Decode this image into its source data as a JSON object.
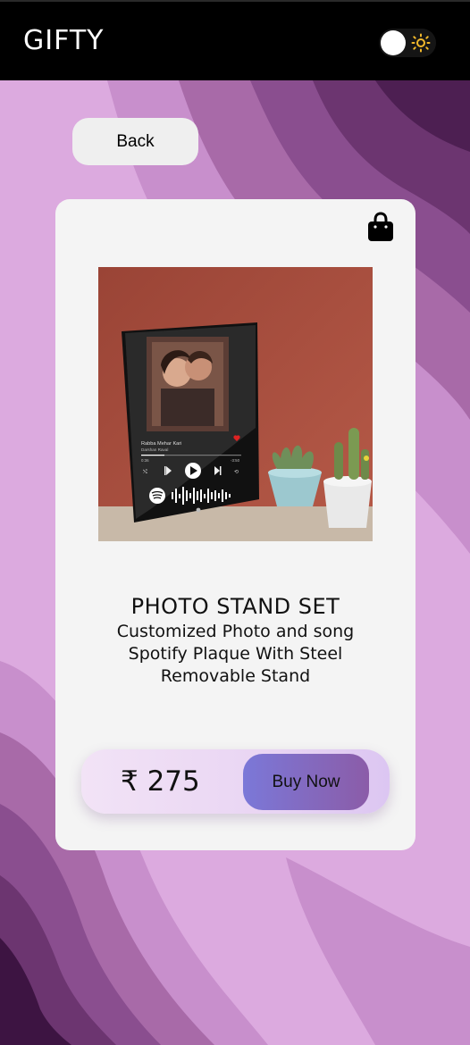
{
  "header": {
    "brand": "GIFTY",
    "theme_toggle_state": "dark"
  },
  "nav": {
    "back_label": "Back"
  },
  "product": {
    "title": "PHOTO STAND SET",
    "description": "Customized Photo and song Spotify Plaque With Steel Removable Stand",
    "price": "₹ 275",
    "buy_label": "Buy Now",
    "plaque": {
      "song": "Rabba Mehar Kari",
      "artist": "Darshan Raval",
      "elapsed": "0:36",
      "remaining": "-3:50"
    }
  },
  "colors": {
    "header_bg": "#000000",
    "card_bg": "#f4f4f4",
    "buy_gradient_start": "#7b78d8",
    "buy_gradient_end": "#8b5ca8",
    "sun": "#f2b92b"
  }
}
